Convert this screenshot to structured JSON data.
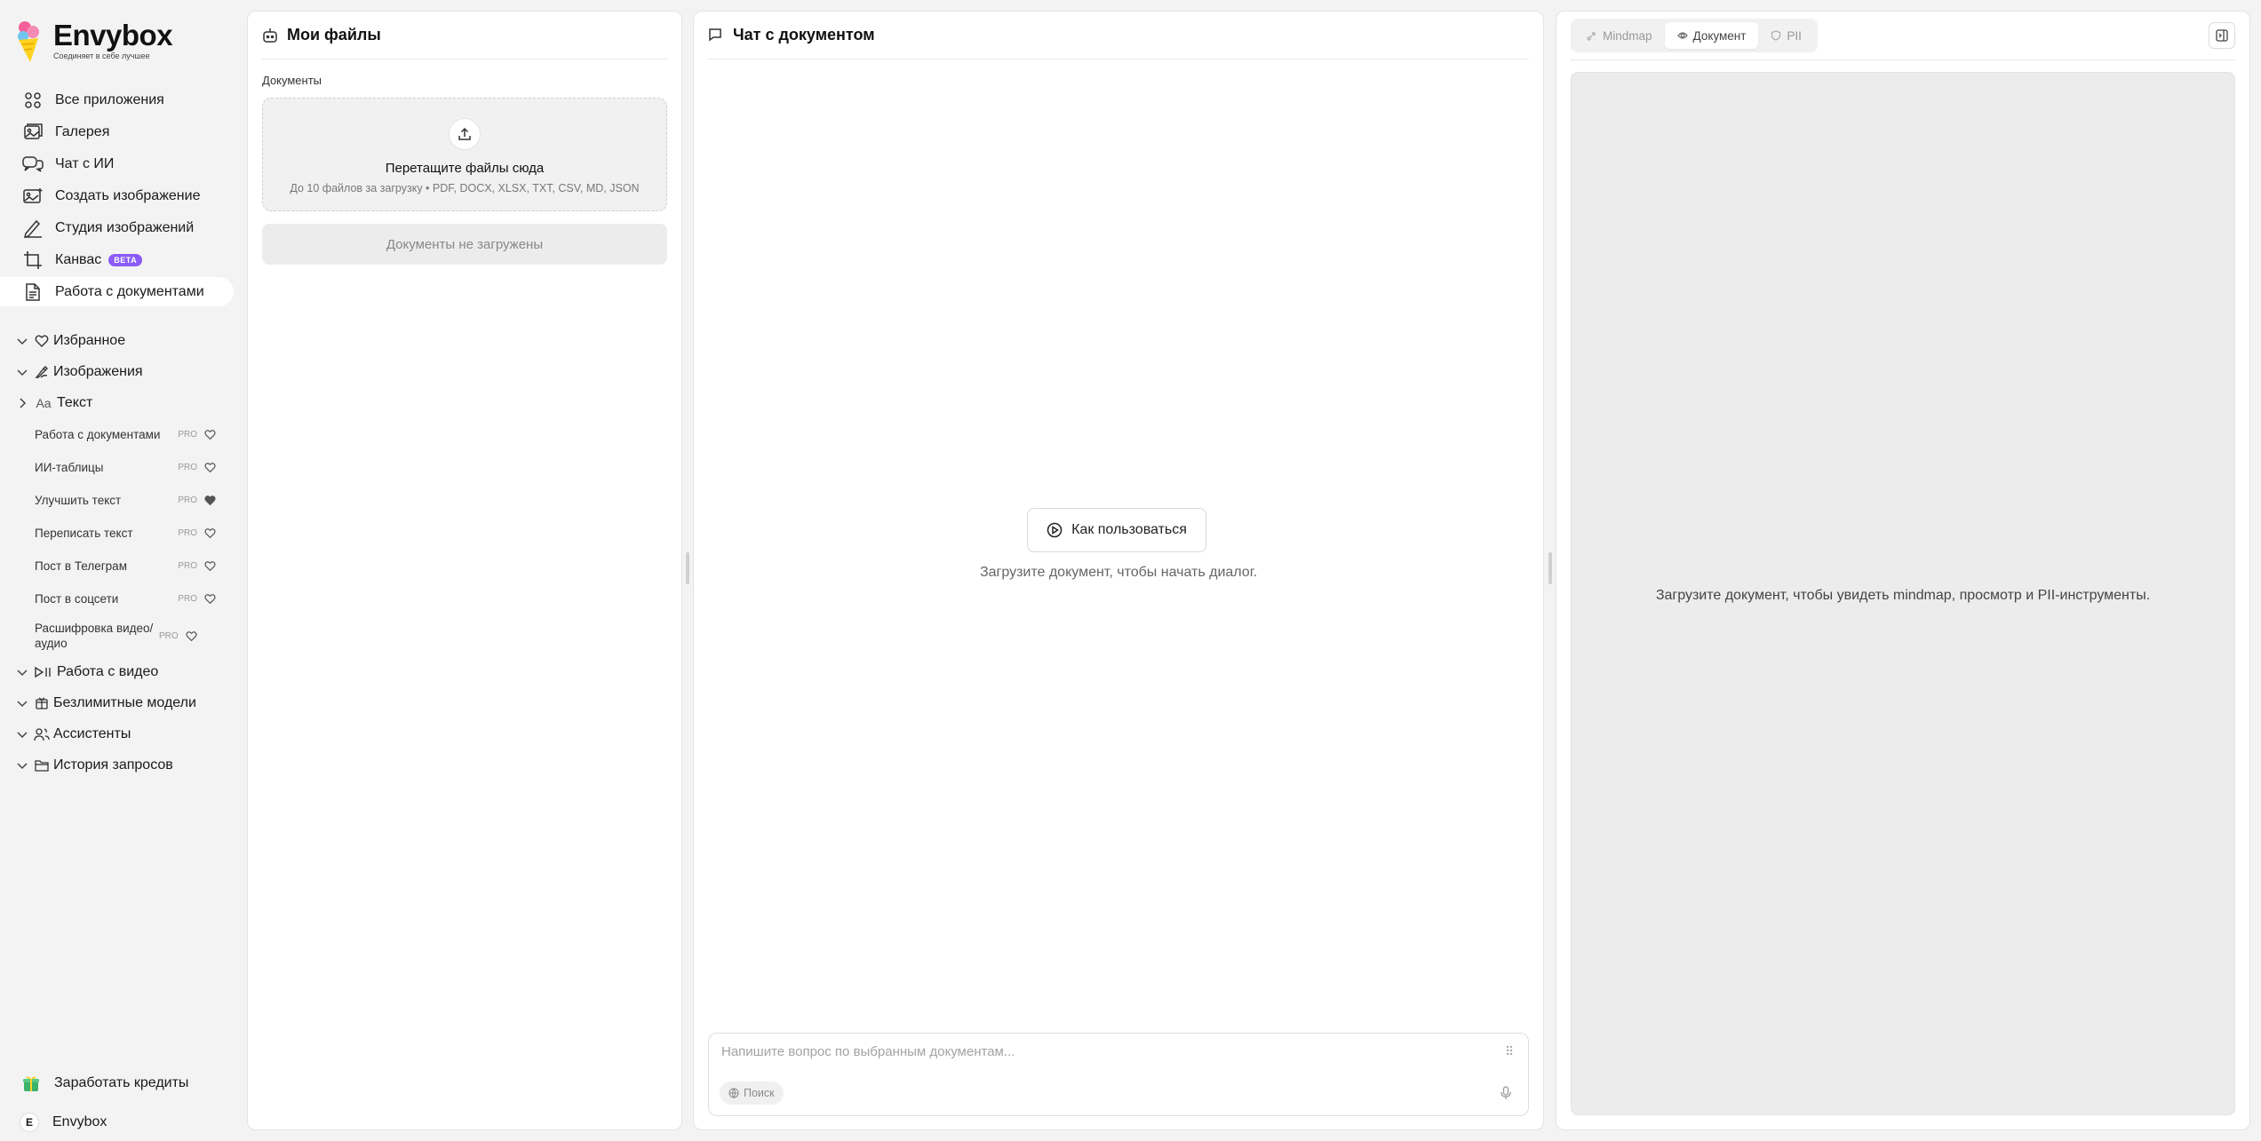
{
  "brand": {
    "name": "Envybox",
    "tagline": "Соединяет в себе лучшее"
  },
  "nav": {
    "items": [
      {
        "label": "Все приложения",
        "icon": "apps-grid-icon"
      },
      {
        "label": "Галерея",
        "icon": "gallery-icon"
      },
      {
        "label": "Чат с ИИ",
        "icon": "chat-icon"
      },
      {
        "label": "Создать изображение",
        "icon": "image-create-icon"
      },
      {
        "label": "Студия изображений",
        "icon": "pen-icon"
      },
      {
        "label": "Канвас",
        "icon": "crop-icon",
        "badge": "BETA"
      },
      {
        "label": "Работа с документами",
        "icon": "document-icon",
        "active": true
      }
    ]
  },
  "groups": {
    "favorites": "Избранное",
    "images": "Изображения",
    "text": {
      "label": "Текст",
      "icon_text": "Aa",
      "items": [
        {
          "label": "Работа с документами",
          "pro": "PRO",
          "liked": false
        },
        {
          "label": "ИИ-таблицы",
          "pro": "PRO",
          "liked": false
        },
        {
          "label": "Улучшить текст",
          "pro": "PRO",
          "liked": true
        },
        {
          "label": "Переписать текст",
          "pro": "PRO",
          "liked": false
        },
        {
          "label": "Пост в Телеграм",
          "pro": "PRO",
          "liked": false
        },
        {
          "label": "Пост в соцсети",
          "pro": "PRO",
          "liked": false
        },
        {
          "label": "Расшифровка видео/ аудио",
          "pro": "PRO",
          "liked": false
        }
      ]
    },
    "video": "Работа с видео",
    "unlimited": "Безлимитные модели",
    "assistants": "Ассистенты",
    "history": "История запросов"
  },
  "bottom": {
    "earn": "Заработать кредиты",
    "user_initial": "E",
    "user_name": "Envybox"
  },
  "files_panel": {
    "title": "Мои файлы",
    "section": "Документы",
    "dropzone_title": "Перетащите файлы сюда",
    "dropzone_sub": "До 10 файлов за загрузку • PDF, DOCX, XLSX, TXT, CSV, MD, JSON",
    "empty": "Документы не загружены"
  },
  "chat_panel": {
    "title": "Чат с документом",
    "how_to": "Как пользоваться",
    "hint": "Загрузите документ, чтобы начать диалог.",
    "input_placeholder": "Напишите вопрос по выбранным документам...",
    "search_chip": "Поиск"
  },
  "preview_panel": {
    "tabs": [
      {
        "label": "Mindmap",
        "active": false
      },
      {
        "label": "Документ",
        "active": true
      },
      {
        "label": "PII",
        "active": false
      }
    ],
    "hint": "Загрузите документ, чтобы увидеть mindmap, просмотр и PII-инструменты."
  }
}
